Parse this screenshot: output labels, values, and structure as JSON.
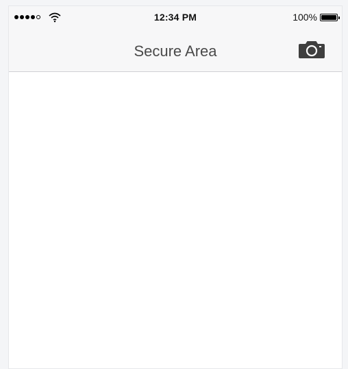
{
  "status_bar": {
    "signal_bars_filled": 4,
    "signal_bars_total": 5,
    "time": "12:34 PM",
    "battery_percent": "100%",
    "battery_level": 1.0,
    "icons": [
      "signal-icon",
      "wifi-icon",
      "battery-icon"
    ]
  },
  "nav": {
    "title": "Secure Area",
    "right_icon": "camera-icon"
  },
  "colors": {
    "background": "#ffffff",
    "bar": "#f7f7f8",
    "title": "#4a4a4a",
    "icon": "#3f3f3f"
  }
}
